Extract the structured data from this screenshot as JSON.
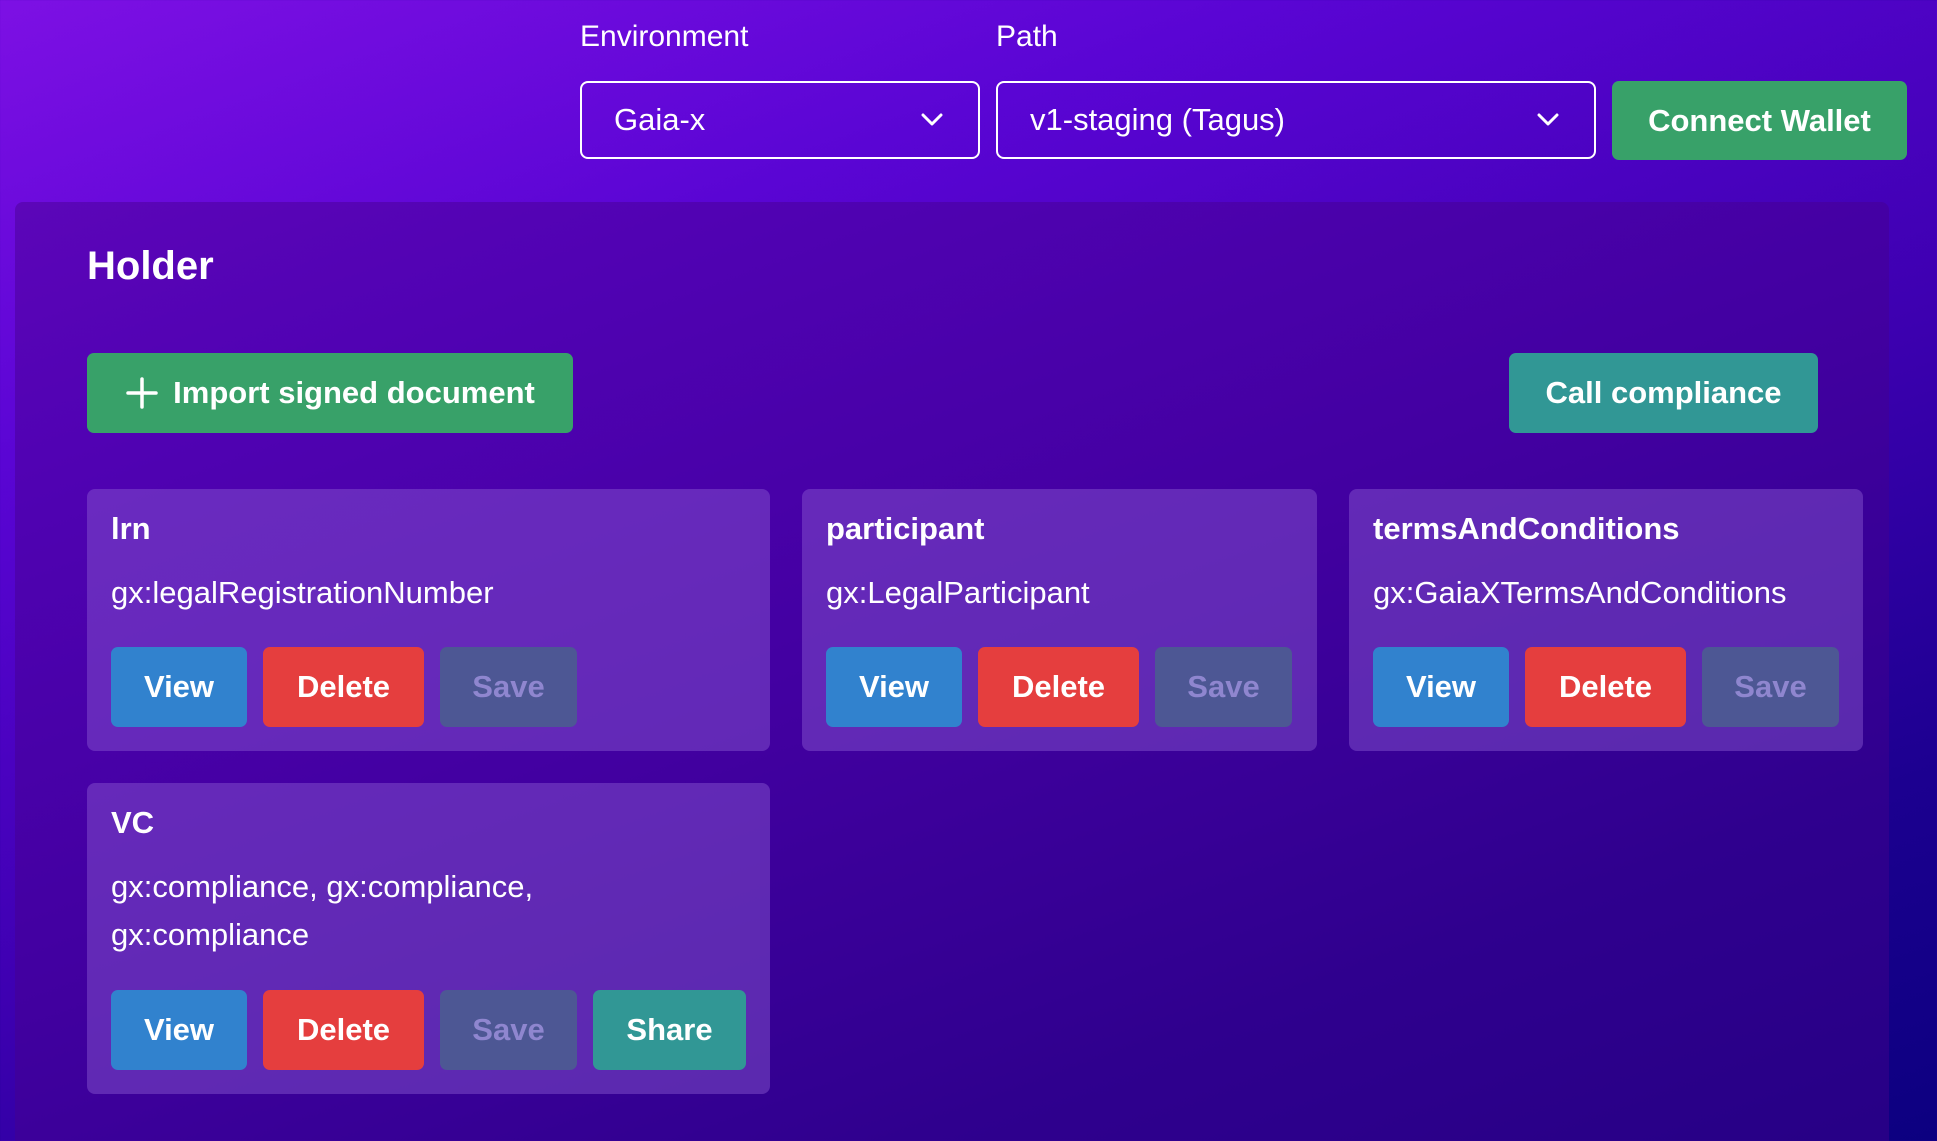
{
  "header": {
    "environment_label": "Environment",
    "environment_value": "Gaia-x",
    "path_label": "Path",
    "path_value": "v1-staging (Tagus)",
    "connect_label": "Connect Wallet"
  },
  "holder": {
    "title": "Holder",
    "import_label": "Import signed document",
    "compliance_label": "Call compliance",
    "cards": [
      {
        "name": "lrn",
        "types": "gx:legalRegistrationNumber",
        "view": "View",
        "delete": "Delete",
        "save": "Save"
      },
      {
        "name": "participant",
        "types": "gx:LegalParticipant",
        "view": "View",
        "delete": "Delete",
        "save": "Save"
      },
      {
        "name": "termsAndConditions",
        "types": "gx:GaiaXTermsAndConditions",
        "view": "View",
        "delete": "Delete",
        "save": "Save"
      },
      {
        "name": "VC",
        "types": "gx:compliance, gx:compliance, gx:compliance",
        "view": "View",
        "delete": "Delete",
        "save": "Save",
        "share": "Share"
      }
    ]
  },
  "colors": {
    "green": "#38a169",
    "teal": "#319795",
    "blue": "#3182ce",
    "red": "#e53e3e",
    "disabled": "#4d5794"
  },
  "icons": {
    "select_arrow": "chevron-down-icon",
    "import": "plus-icon"
  }
}
